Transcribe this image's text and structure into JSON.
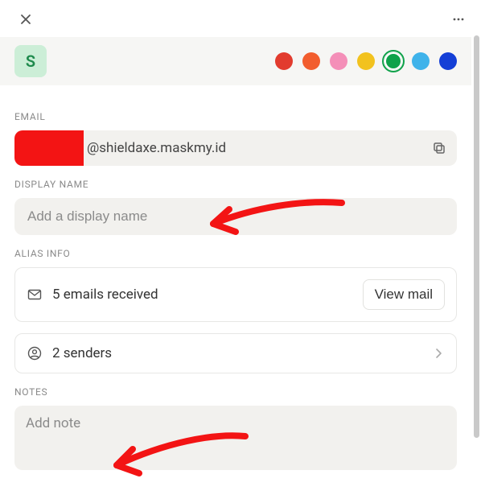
{
  "header": {
    "avatar_initial": "S"
  },
  "colors": [
    {
      "name": "red",
      "hex": "#e23b2e",
      "selected": false
    },
    {
      "name": "orange",
      "hex": "#f25d2e",
      "selected": false
    },
    {
      "name": "pink",
      "hex": "#f48fb8",
      "selected": false
    },
    {
      "name": "yellow",
      "hex": "#f2c21e",
      "selected": false
    },
    {
      "name": "green",
      "hex": "#0fa24a",
      "selected": true
    },
    {
      "name": "skyblue",
      "hex": "#3fb3ea",
      "selected": false
    },
    {
      "name": "blue",
      "hex": "#143fd6",
      "selected": false
    }
  ],
  "sections": {
    "email_label": "EMAIL",
    "display_name_label": "DISPLAY NAME",
    "alias_info_label": "ALIAS INFO",
    "notes_label": "NOTES"
  },
  "email": {
    "domain_part": "@shieldaxe.maskmy.id"
  },
  "display_name": {
    "value": "",
    "placeholder": "Add a display name"
  },
  "alias_info": {
    "emails_received_text": "5 emails received",
    "view_mail_label": "View mail",
    "senders_text": "2 senders"
  },
  "notes": {
    "value": "",
    "placeholder": "Add note"
  }
}
